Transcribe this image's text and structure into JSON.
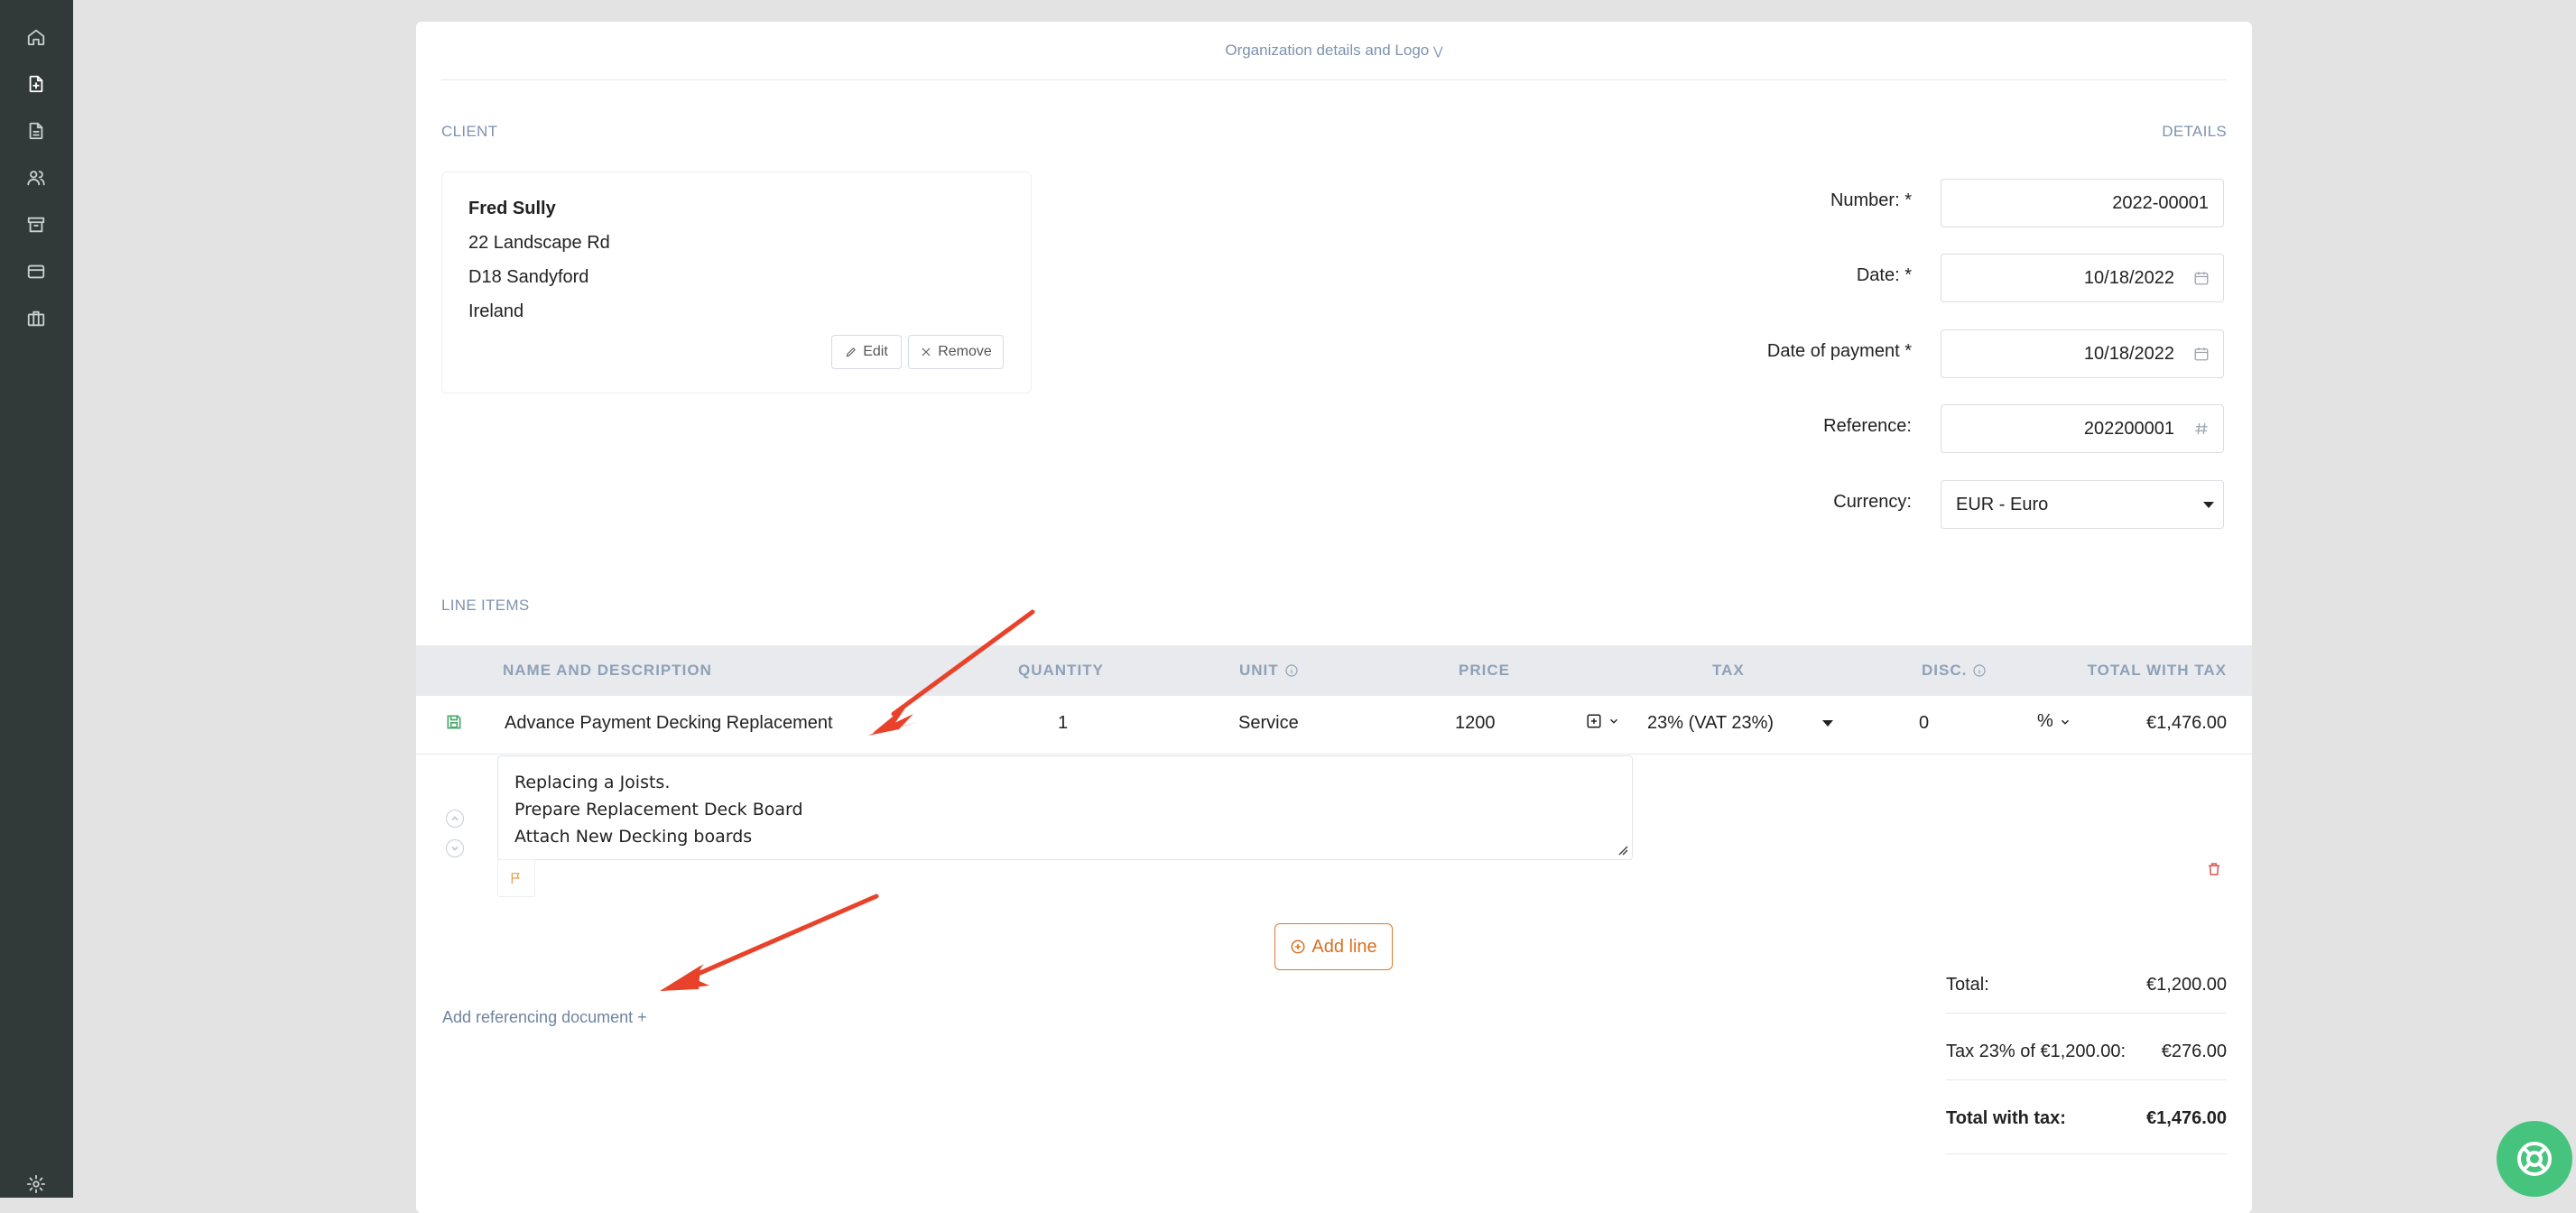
{
  "sidebar": {
    "items": [
      {
        "icon": "home-icon"
      },
      {
        "icon": "new-document-icon",
        "active": true
      },
      {
        "icon": "document-icon"
      },
      {
        "icon": "users-icon"
      },
      {
        "icon": "archive-icon"
      },
      {
        "icon": "credit-card-icon"
      },
      {
        "icon": "briefcase-icon"
      }
    ],
    "settings_icon": "gear-icon"
  },
  "header": {
    "org_link": "Organization details and Logo"
  },
  "client": {
    "section_label": "CLIENT",
    "name": "Fred Sully",
    "address_line1": "22 Landscape Rd",
    "address_line2": "D18 Sandyford",
    "country": "Ireland",
    "edit_label": "Edit",
    "remove_label": "Remove"
  },
  "details": {
    "section_label": "DETAILS",
    "number_label": "Number:",
    "number_value": "2022-00001",
    "date_label": "Date:",
    "date_value": "10/18/2022",
    "payment_date_label": "Date of payment",
    "payment_date_value": "10/18/2022",
    "reference_label": "Reference:",
    "reference_value": "202200001",
    "currency_label": "Currency:",
    "currency_value": "EUR - Euro",
    "required_mark": "*"
  },
  "line_items": {
    "section_label": "LINE ITEMS",
    "columns": {
      "name": "NAME AND DESCRIPTION",
      "quantity": "QUANTITY",
      "unit": "UNIT",
      "price": "PRICE",
      "tax": "TAX",
      "discount": "DISC.",
      "total": "TOTAL WITH TAX"
    },
    "row": {
      "name": "Advance Payment Decking Replacement",
      "quantity": "1",
      "unit": "Service",
      "price": "1200",
      "tax": "23% (VAT 23%)",
      "discount": "0",
      "discount_type": "%",
      "total": "€1,476.00",
      "description_lines": [
        "Replacing a Joists.",
        "Prepare Replacement Deck Board",
        "Attach New Decking boards"
      ]
    },
    "add_line_label": "Add line",
    "add_reference_label": "Add referencing document +"
  },
  "totals": {
    "total_label": "Total:",
    "total_value": "€1,200.00",
    "tax_label": "Tax 23% of €1,200.00:",
    "tax_value": "€276.00",
    "grand_label": "Total with tax:",
    "grand_value": "€1,476.00"
  },
  "colors": {
    "accent": "#d8701f",
    "annotation_arrow": "#e8432a",
    "help_button": "#46c47e",
    "sidebar": "#323a39"
  }
}
